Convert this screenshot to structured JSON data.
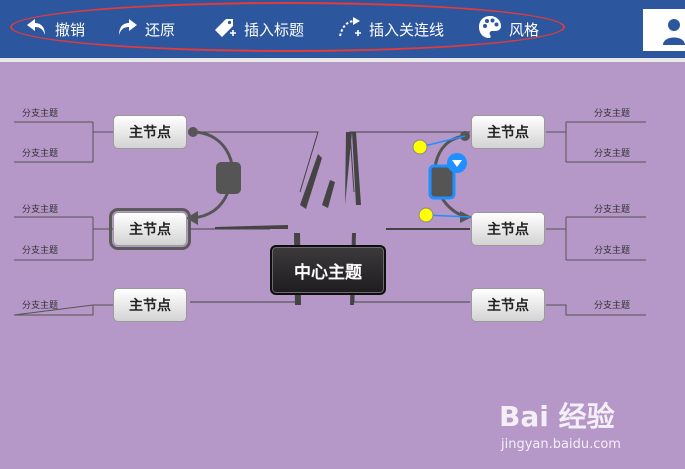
{
  "toolbar": {
    "undo": "撤销",
    "redo": "还原",
    "insert_label": "插入标题",
    "insert_relation": "插入关连线",
    "style": "风格"
  },
  "mindmap": {
    "center": "中心主题",
    "nodes": [
      "主节点",
      "主节点",
      "主节点",
      "主节点",
      "主节点",
      "主节点"
    ],
    "branch": "分支主题"
  },
  "watermark": {
    "logo": "Bai 经验",
    "url": "jingyan.baidu.com"
  },
  "colors": {
    "toolbar_bg": "#2c579e",
    "canvas_bg": "#b597c8",
    "highlight_ellipse": "#e23b3b",
    "connector_handle": "#ffff00",
    "selection_blue": "#1e90ff"
  }
}
